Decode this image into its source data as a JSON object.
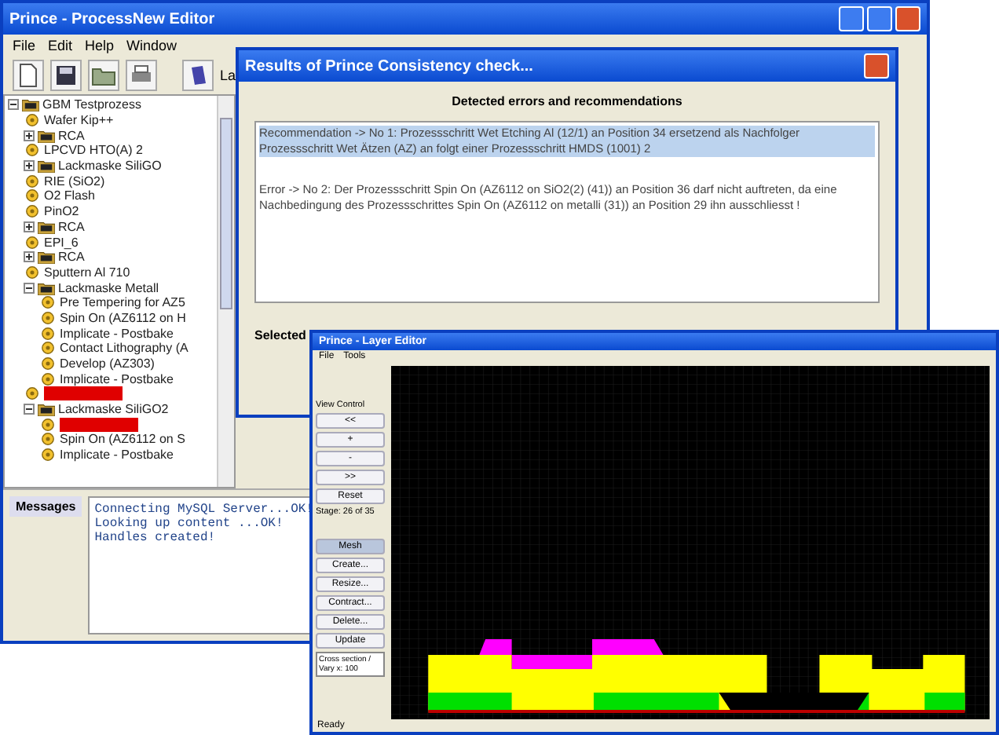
{
  "main_window": {
    "title": "Prince - ProcessNew Editor",
    "menu": [
      "File",
      "Edit",
      "Help",
      "Window"
    ],
    "toolbar_text": "La",
    "tree": [
      {
        "label": "GBM Testprozess",
        "kind": "folder",
        "expanded": true,
        "children": [
          {
            "label": "Wafer Kip++",
            "kind": "step"
          },
          {
            "label": "RCA",
            "kind": "folder",
            "expanded": false
          },
          {
            "label": "LPCVD HTO(A) 2",
            "kind": "step"
          },
          {
            "label": "Lackmaske SiliGO",
            "kind": "folder",
            "expanded": false
          },
          {
            "label": "RIE (SiO2)",
            "kind": "step"
          },
          {
            "label": "O2 Flash",
            "kind": "step"
          },
          {
            "label": "PinO2",
            "kind": "step"
          },
          {
            "label": "RCA",
            "kind": "folder",
            "expanded": false
          },
          {
            "label": "EPI_6",
            "kind": "step"
          },
          {
            "label": "RCA",
            "kind": "folder",
            "expanded": false
          },
          {
            "label": "Sputtern Al 710",
            "kind": "step"
          },
          {
            "label": "Lackmaske Metall",
            "kind": "folder",
            "expanded": true,
            "children": [
              {
                "label": "Pre Tempering for AZ5",
                "kind": "step"
              },
              {
                "label": "Spin On (AZ6112 on H",
                "kind": "step"
              },
              {
                "label": "Implicate - Postbake",
                "kind": "step"
              },
              {
                "label": "Contact Lithography (A",
                "kind": "step"
              },
              {
                "label": "Develop (AZ303)",
                "kind": "step"
              },
              {
                "label": "Implicate - Postbake",
                "kind": "step"
              }
            ]
          },
          {
            "kind": "step",
            "error": true
          },
          {
            "label": "Lackmaske SiliGO2",
            "kind": "folder",
            "expanded": true,
            "children": [
              {
                "kind": "step",
                "error": true
              },
              {
                "label": "Spin On (AZ6112 on S",
                "kind": "step"
              },
              {
                "label": "Implicate - Postbake",
                "kind": "step"
              }
            ]
          }
        ]
      }
    ],
    "messages_tab": "Messages",
    "messages": [
      "Connecting MySQL Server...OK!",
      "Looking up content ...OK!",
      "Handles created!"
    ]
  },
  "dialog": {
    "title": "Results of Prince Consistency check...",
    "heading": "Detected errors and recommendations",
    "entries": [
      {
        "text": "Recommendation -> No 1: Prozessschritt Wet Etching Al (12/1) an Position 34 ersetzend als Nachfolger Prozessschritt Wet Ätzen (AZ) an folgt einer Prozessschritt HMDS (1001) 2",
        "selected": true
      },
      {
        "text": "Error -> No 2: Der Prozessschritt Spin On (AZ6112 on SiO2(2) (41)) an Position 36 darf nicht auftreten, da eine Nachbedingung des Prozessschrittes Spin On (AZ6112 on metalli (31)) an Position 29 ihn ausschliesst !",
        "selected": false
      }
    ],
    "footer_label": "Selected"
  },
  "layer_editor": {
    "title": "Prince - Layer Editor",
    "menu": [
      "File",
      "Tools"
    ],
    "controls": [
      {
        "kind": "label",
        "label": "View Control"
      },
      {
        "kind": "button",
        "label": "<<",
        "selected": false
      },
      {
        "kind": "button",
        "label": "+",
        "selected": false
      },
      {
        "kind": "button",
        "label": "-",
        "selected": false
      },
      {
        "kind": "button",
        "label": ">>",
        "selected": false
      },
      {
        "kind": "button",
        "label": "Reset",
        "selected": false
      },
      {
        "kind": "label",
        "label": "Stage: 26 of 35"
      },
      {
        "kind": "gap"
      },
      {
        "kind": "button",
        "label": "Mesh",
        "selected": true
      },
      {
        "kind": "button",
        "label": "Create...",
        "selected": false
      },
      {
        "kind": "button",
        "label": "Resize...",
        "selected": false
      },
      {
        "kind": "button",
        "label": "Contract...",
        "selected": false
      },
      {
        "kind": "button",
        "label": "Delete...",
        "selected": false
      },
      {
        "kind": "button",
        "label": "Update",
        "selected": false
      },
      {
        "kind": "info",
        "label": "Cross section / Vary x: 100"
      }
    ],
    "status": "Ready"
  }
}
